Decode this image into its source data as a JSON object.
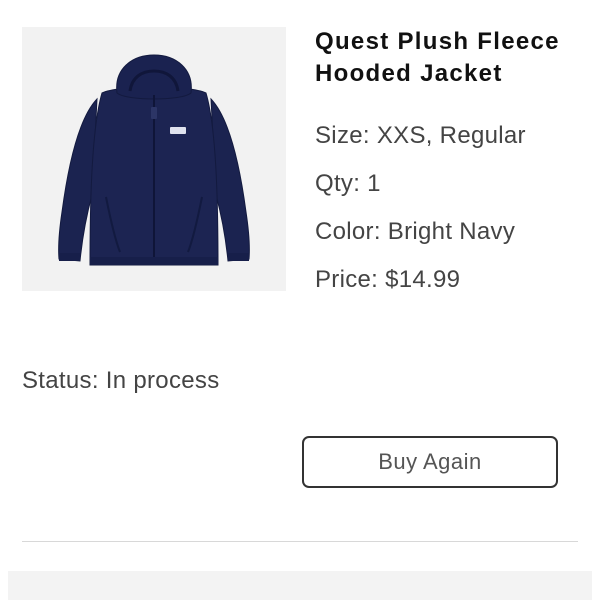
{
  "product": {
    "title": "Quest Plush Fleece Hooded Jacket",
    "image_alt": "navy-fleece-hooded-jacket",
    "size": "Size: XXS, Regular",
    "qty": "Qty: 1",
    "color": "Color: Bright Navy",
    "price": "Price: $14.99"
  },
  "order": {
    "status": "Status: In process"
  },
  "actions": {
    "buy_again_label": "Buy Again"
  },
  "colors": {
    "jacket": "#1b2350",
    "thumbnail_bg": "#f2f2f2",
    "button_border": "#333333"
  }
}
